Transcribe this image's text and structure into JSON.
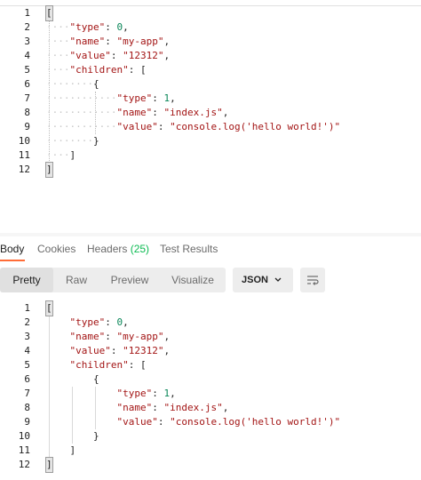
{
  "editor_lines": [
    {
      "n": "1"
    },
    {
      "n": "2"
    },
    {
      "n": "3"
    },
    {
      "n": "4"
    },
    {
      "n": "5"
    },
    {
      "n": "6"
    },
    {
      "n": "7"
    },
    {
      "n": "8"
    },
    {
      "n": "9"
    },
    {
      "n": "10"
    },
    {
      "n": "11"
    },
    {
      "n": "12"
    }
  ],
  "json": {
    "open": "[",
    "close": "]",
    "obj_open": "{",
    "obj_close": "}",
    "type_key": "\"type\"",
    "type_val": "0",
    "name_key": "\"name\"",
    "name_val": "\"my-app\"",
    "value_key": "\"value\"",
    "value_val": "\"12312\"",
    "children_key": "\"children\"",
    "child_type_val": "1",
    "child_name_val": "\"index.js\"",
    "child_value_val": "\"console.log('hello world!')\""
  },
  "tabs": {
    "body": "Body",
    "cookies": "Cookies",
    "headers": "Headers",
    "headers_count": "(25)",
    "test_results": "Test Results"
  },
  "toolbar": {
    "pretty": "Pretty",
    "raw": "Raw",
    "preview": "Preview",
    "visualize": "Visualize",
    "format": "JSON"
  },
  "colors": {
    "accent": "#ff6c37",
    "headers_count": "#0cbb52"
  }
}
